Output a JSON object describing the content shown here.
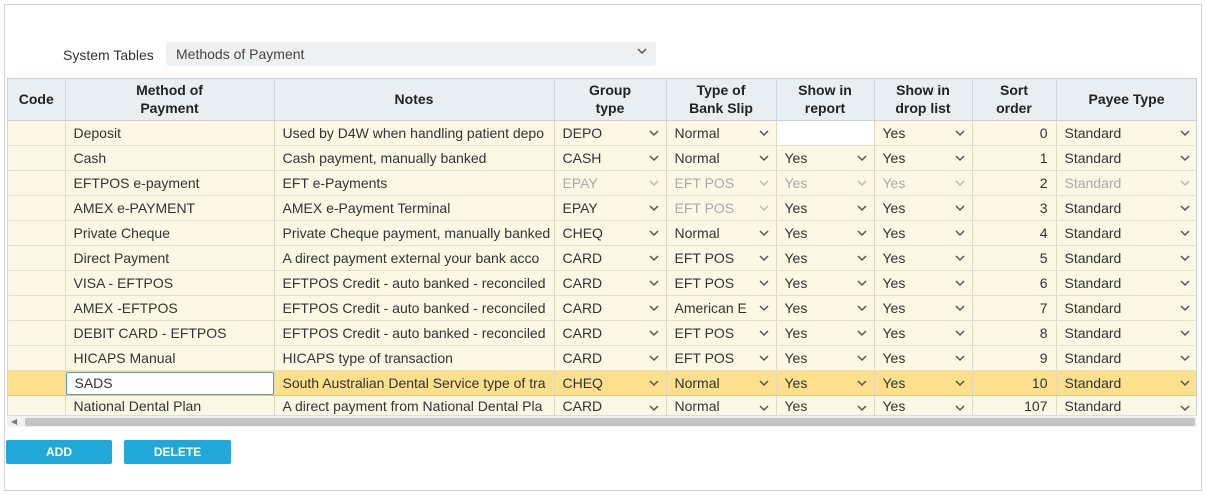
{
  "system_tables": {
    "label": "System Tables",
    "selected": "Methods of Payment"
  },
  "columns": [
    "Code",
    "Method of\nPayment",
    "Notes",
    "Group\ntype",
    "Type of\nBank Slip",
    "Show in\nreport",
    "Show in\ndrop list",
    "Sort\norder",
    "Payee Type"
  ],
  "rows": [
    {
      "code": "",
      "method": "Deposit",
      "notes": "Used by D4W when handling patient depo",
      "group": "DEPO",
      "slip": "Normal",
      "report": "",
      "droplist": "Yes",
      "sort": "0",
      "payee": "Standard"
    },
    {
      "code": "",
      "method": "Cash",
      "notes": "Cash payment, manually banked",
      "group": "CASH",
      "slip": "Normal",
      "report": "Yes",
      "droplist": "Yes",
      "sort": "1",
      "payee": "Standard"
    },
    {
      "code": "",
      "method": "EFTPOS e-payment",
      "notes": "EFT e-Payments",
      "group": "EPAY",
      "slip": "EFT POS",
      "report": "Yes",
      "droplist": "Yes",
      "sort": "2",
      "payee": "Standard"
    },
    {
      "code": "",
      "method": "AMEX e-PAYMENT",
      "notes": "AMEX e-Payment Terminal",
      "group": "EPAY",
      "slip": "EFT POS",
      "report": "Yes",
      "droplist": "Yes",
      "sort": "3",
      "payee": "Standard"
    },
    {
      "code": "",
      "method": "Private Cheque",
      "notes": "Private Cheque payment, manually banked",
      "group": "CHEQ",
      "slip": "Normal",
      "report": "Yes",
      "droplist": "Yes",
      "sort": "4",
      "payee": "Standard"
    },
    {
      "code": "",
      "method": "Direct Payment",
      "notes": "A direct payment external your bank acco",
      "group": "CARD",
      "slip": "EFT POS",
      "report": "Yes",
      "droplist": "Yes",
      "sort": "5",
      "payee": "Standard"
    },
    {
      "code": "",
      "method": "VISA - EFTPOS",
      "notes": "EFTPOS Credit - auto banked - reconciled",
      "group": "CARD",
      "slip": "EFT POS",
      "report": "Yes",
      "droplist": "Yes",
      "sort": "6",
      "payee": "Standard"
    },
    {
      "code": "",
      "method": "AMEX -EFTPOS",
      "notes": "EFTPOS Credit - auto banked - reconciled",
      "group": "CARD",
      "slip": "American E",
      "report": "Yes",
      "droplist": "Yes",
      "sort": "7",
      "payee": "Standard"
    },
    {
      "code": "",
      "method": "DEBIT CARD - EFTPOS",
      "notes": "EFTPOS Credit - auto banked - reconciled",
      "group": "CARD",
      "slip": "EFT POS",
      "report": "Yes",
      "droplist": "Yes",
      "sort": "8",
      "payee": "Standard"
    },
    {
      "code": "",
      "method": "HICAPS Manual",
      "notes": "HICAPS type of transaction",
      "group": "CARD",
      "slip": "EFT POS",
      "report": "Yes",
      "droplist": "Yes",
      "sort": "9",
      "payee": "Standard"
    },
    {
      "code": "",
      "method": "SADS",
      "notes": "South Australian Dental Service type of tra",
      "group": "CHEQ",
      "slip": "Normal",
      "report": "Yes",
      "droplist": "Yes",
      "sort": "10",
      "payee": "Standard"
    },
    {
      "code": "",
      "method": "National Dental Plan",
      "notes": "A direct payment from National Dental Pla",
      "group": "CARD",
      "slip": "Normal",
      "report": "Yes",
      "droplist": "Yes",
      "sort": "107",
      "payee": "Standard"
    }
  ],
  "buttons": {
    "add": "ADD",
    "delete": "DELETE"
  },
  "colors": {
    "accent": "#21a7d8",
    "row_bg": "#fdf7e5",
    "selected_row": "#fce08d",
    "header_bg": "#e9eef2"
  }
}
